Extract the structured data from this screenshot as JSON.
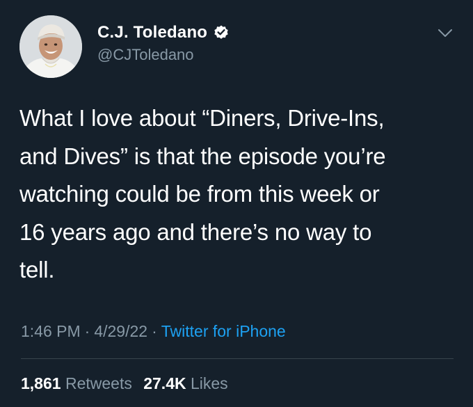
{
  "user": {
    "display_name": "C.J. Toledano",
    "handle": "@CJToledano",
    "verified": true,
    "avatar_icon": "profile-photo"
  },
  "tweet": {
    "text_lines": [
      "What I love about “Diners, Drive-Ins,",
      "and Dives” is that the episode you’re",
      "watching could be from this week or",
      "16 years ago and there’s no way to",
      "tell."
    ],
    "time": "1:46 PM",
    "separator": "·",
    "date": "4/29/22",
    "source": "Twitter for iPhone"
  },
  "stats": {
    "retweets_count": "1,861",
    "retweets_label": "Retweets",
    "likes_count": "27.4K",
    "likes_label": "Likes"
  },
  "colors": {
    "background": "#15202b",
    "secondary_text": "#8899a6",
    "link": "#1da1f2",
    "verified_badge": "#ffffff"
  }
}
